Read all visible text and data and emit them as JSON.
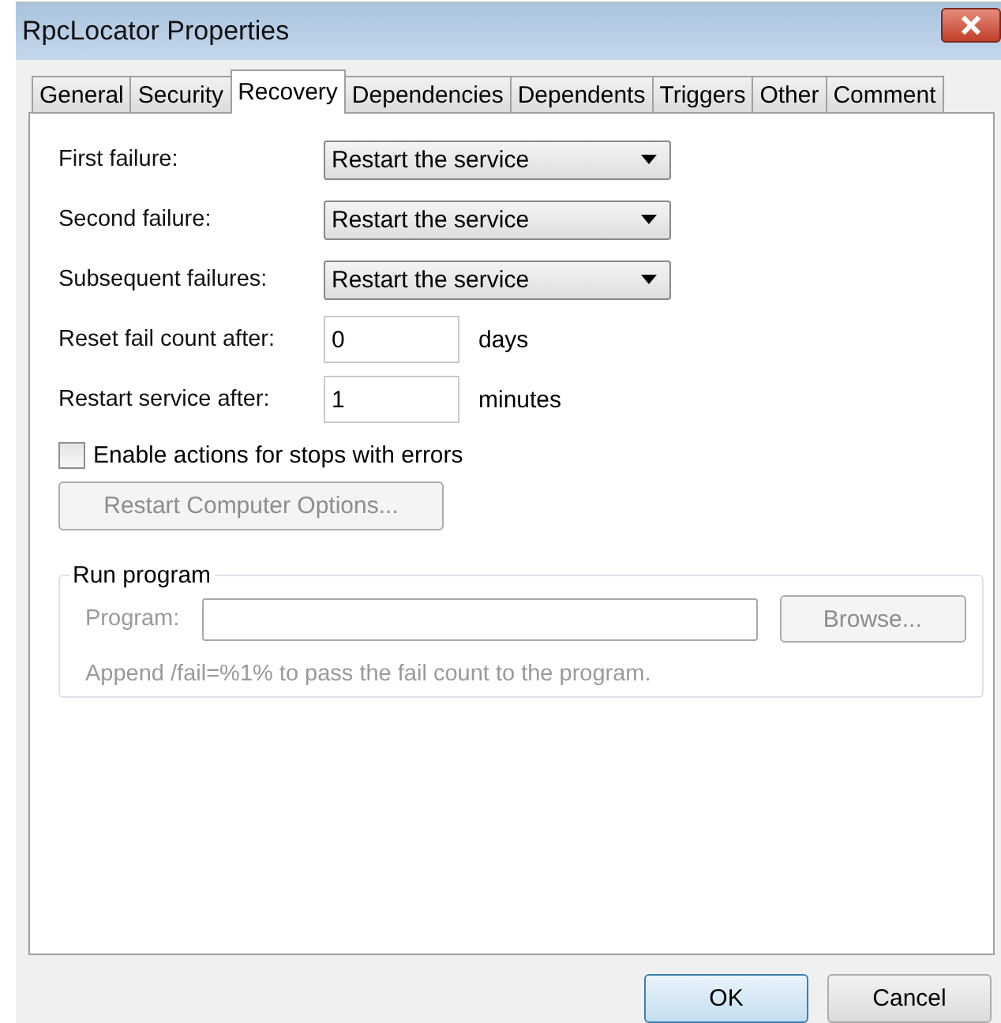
{
  "window": {
    "title": "RpcLocator Properties"
  },
  "tabs": [
    {
      "label": "General",
      "selected": false
    },
    {
      "label": "Security",
      "selected": false
    },
    {
      "label": "Recovery",
      "selected": true
    },
    {
      "label": "Dependencies",
      "selected": false
    },
    {
      "label": "Dependents",
      "selected": false
    },
    {
      "label": "Triggers",
      "selected": false
    },
    {
      "label": "Other",
      "selected": false
    },
    {
      "label": "Comment",
      "selected": false
    }
  ],
  "failures": [
    {
      "label": "First failure:",
      "value": "Restart the service"
    },
    {
      "label": "Second failure:",
      "value": "Restart the service"
    },
    {
      "label": "Subsequent failures:",
      "value": "Restart the service"
    }
  ],
  "counters": [
    {
      "label": "Reset fail count after:",
      "value": "0",
      "unit": "days"
    },
    {
      "label": "Restart service after:",
      "value": "1",
      "unit": "minutes"
    }
  ],
  "enable_actions": {
    "label": "Enable actions for stops with errors",
    "checked": false
  },
  "restart_computer": {
    "label": "Restart Computer Options...",
    "disabled": true
  },
  "run_program": {
    "title": "Run program",
    "program_label": "Program:",
    "browse_label": "Browse...",
    "hint": "Append /fail=%1% to pass the fail count to the program.",
    "disabled": true
  },
  "buttons": [
    {
      "label": "OK",
      "default": true
    },
    {
      "label": "Cancel",
      "default": false
    }
  ]
}
